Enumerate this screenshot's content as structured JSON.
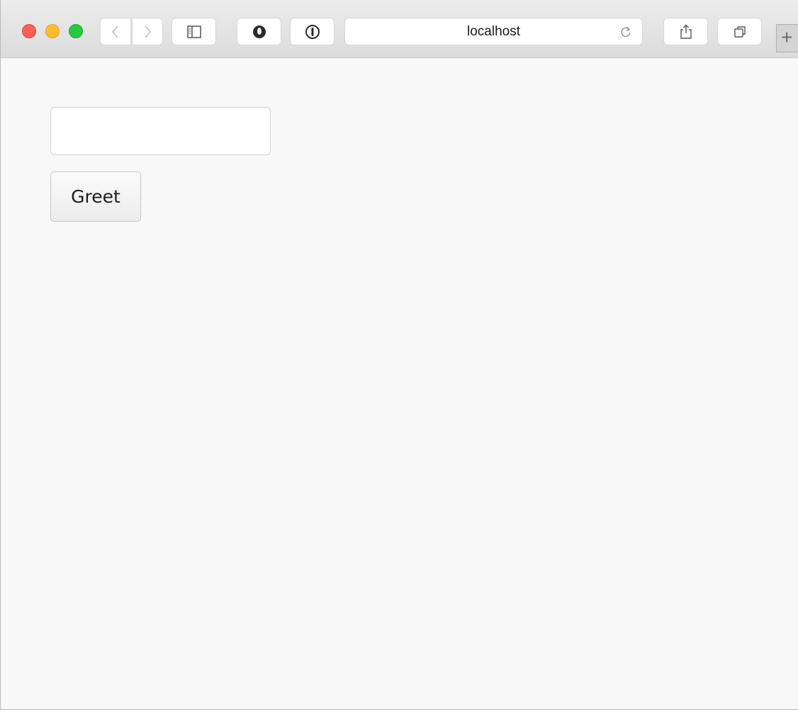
{
  "browser": {
    "address_bar": "localhost",
    "new_tab_symbol": "+",
    "icons": {
      "back": "chevron-left-icon",
      "forward": "chevron-right-icon",
      "sidebar": "sidebar-icon",
      "extension_1": "ghostery-icon",
      "extension_2": "onepassword-icon",
      "reload": "reload-icon",
      "share": "share-icon",
      "tabs": "tabs-icon"
    },
    "traffic_lights": {
      "close": "#fc5f57",
      "minimize": "#fdbc2e",
      "zoom": "#28c840"
    }
  },
  "page": {
    "name_input": {
      "value": "",
      "placeholder": ""
    },
    "greet_button_label": "Greet"
  }
}
